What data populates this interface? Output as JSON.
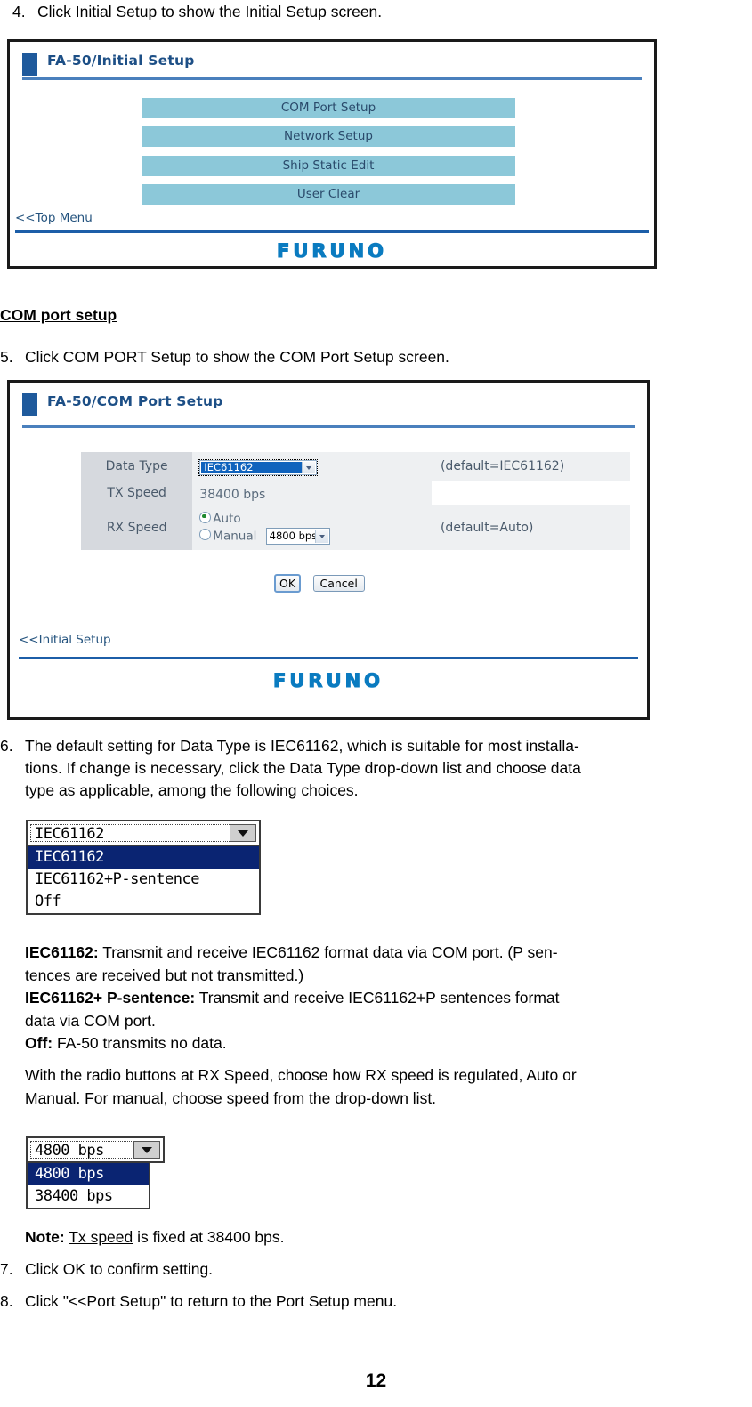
{
  "page": {
    "number": "12"
  },
  "step4": {
    "num": "4.",
    "text": "Click Initial Setup to show the Initial Setup screen."
  },
  "initial_setup_panel": {
    "tab_title": "FA-50/Initial Setup",
    "menu_items": [
      {
        "label": "COM Port Setup"
      },
      {
        "label": "Network Setup"
      },
      {
        "label": "Ship Static Edit"
      },
      {
        "label": "User Clear"
      }
    ],
    "back_link": "<<Top Menu",
    "logo": "FURUNO",
    "colors": {
      "tab_blue": "#1f5a9c",
      "title_blue": "#1d4f86",
      "button_blue": "#8cc8d9",
      "logo_blue": "#0a7bc0"
    }
  },
  "section_heading": "COM port setup",
  "step5": {
    "num": "5.",
    "text": "Click COM PORT Setup to show the COM Port Setup screen."
  },
  "com_port_panel": {
    "tab_title": "FA-50/COM Port Setup",
    "rows": [
      {
        "label": "Data Type",
        "value": "IEC61162",
        "note": "(default=IEC61162)"
      },
      {
        "label": "TX Speed",
        "value": "38400 bps",
        "note": ""
      },
      {
        "label": "RX Speed",
        "radio_auto": "Auto",
        "radio_manual": "Manual",
        "manual_speed": "4800 bps",
        "note": "(default=Auto)"
      }
    ],
    "ok_label": "OK",
    "cancel_label": "Cancel",
    "back_link": "<<Initial Setup",
    "logo": "FURUNO"
  },
  "step6": {
    "num": "6.",
    "line1": "The default setting for Data Type is IEC61162, which is suitable for most installa-",
    "line2": "tions. If change is necessary, click the Data Type drop-down list and choose data",
    "line3": "type as applicable, among the following choices."
  },
  "datatype_dropdown": {
    "current": "IEC61162",
    "options": [
      {
        "label": "IEC61162",
        "highlighted": true
      },
      {
        "label": "IEC61162+P-sentence",
        "highlighted": false
      },
      {
        "label": "Off",
        "highlighted": false
      }
    ]
  },
  "definitions": {
    "iec_term": "IEC61162:",
    "iec_desc_l1": " Transmit and receive IEC61162 format data via COM port. (P sen-",
    "iec_desc_l2": "tences are received but not transmitted.)",
    "iecp_term": "IEC61162+ P-sentence:",
    "iecp_desc_l1": " Transmit and receive IEC61162+P sentences format",
    "iecp_desc_l2": "data via COM port.",
    "off_term": "Off:",
    "off_desc": " FA-50 transmits no data."
  },
  "rx_paragraph": {
    "line1": "With the radio buttons at RX Speed, choose how RX speed is regulated, Auto or",
    "line2": "Manual. For manual, choose speed from the drop-down list."
  },
  "speed_dropdown": {
    "current": "4800 bps",
    "options": [
      {
        "label": "4800 bps",
        "highlighted": true
      },
      {
        "label": "38400 bps",
        "highlighted": false
      }
    ]
  },
  "note": {
    "term": "Note:",
    "underlined": "Tx speed",
    "rest": " is fixed at 38400 bps."
  },
  "step7": {
    "num": "7.",
    "text": "Click OK to confirm setting."
  },
  "step8": {
    "num": "8.",
    "text": "Click \"<<Port Setup\" to return to the Port Setup menu."
  }
}
